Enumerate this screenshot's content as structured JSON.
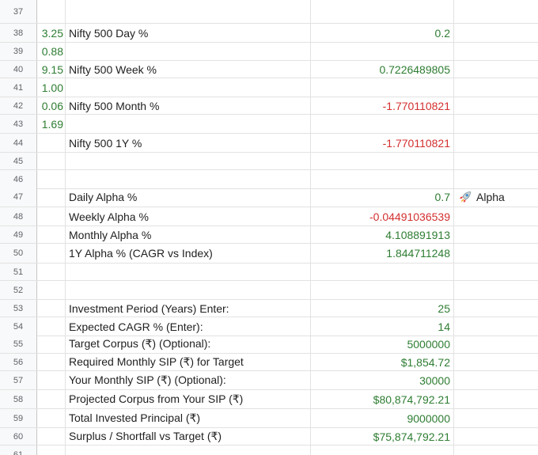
{
  "rows": [
    {
      "num": "37",
      "a": "",
      "b": "",
      "c": "",
      "d": ""
    },
    {
      "num": "38",
      "a": "3.25",
      "b": "Nifty 500 Day %",
      "c": "0.2",
      "d": ""
    },
    {
      "num": "39",
      "a": "0.88",
      "b": "",
      "c": "",
      "d": ""
    },
    {
      "num": "40",
      "a": "9.15",
      "b": "Nifty 500 Week %",
      "c": "0.7226489805",
      "d": ""
    },
    {
      "num": "41",
      "a": "1.00",
      "b": "",
      "c": "",
      "d": ""
    },
    {
      "num": "42",
      "a": "0.06",
      "b": "Nifty 500 Month %",
      "c": "-1.770110821",
      "d": ""
    },
    {
      "num": "43",
      "a": "1.69",
      "b": "",
      "c": "",
      "d": ""
    },
    {
      "num": "44",
      "a": "",
      "b": "Nifty 500 1Y %",
      "c": "-1.770110821",
      "d": ""
    },
    {
      "num": "45",
      "a": "",
      "b": "",
      "c": "",
      "d": ""
    },
    {
      "num": "46",
      "a": "",
      "b": "",
      "c": "",
      "d": ""
    },
    {
      "num": "47",
      "a": "",
      "b": "Daily Alpha %",
      "c": "0.7",
      "d": "Alpha"
    },
    {
      "num": "48",
      "a": "",
      "b": "Weekly Alpha %",
      "c": "-0.04491036539",
      "d": ""
    },
    {
      "num": "49",
      "a": "",
      "b": "Monthly Alpha %",
      "c": "4.108891913",
      "d": ""
    },
    {
      "num": "50",
      "a": "",
      "b": "1Y Alpha % (CAGR vs Index)",
      "c": "1.844711248",
      "d": ""
    },
    {
      "num": "51",
      "a": "",
      "b": "",
      "c": "",
      "d": ""
    },
    {
      "num": "52",
      "a": "",
      "b": "",
      "c": "",
      "d": ""
    },
    {
      "num": "53",
      "a": "",
      "b": "Investment Period (Years) Enter:",
      "c": "25",
      "d": ""
    },
    {
      "num": "54",
      "a": "",
      "b": "Expected CAGR % (Enter):",
      "c": "14",
      "d": ""
    },
    {
      "num": "55",
      "a": "",
      "b": "Target Corpus (₹) (Optional):",
      "c": "5000000",
      "d": ""
    },
    {
      "num": "56",
      "a": "",
      "b": "Required Monthly SIP (₹) for Target",
      "c": "$1,854.72",
      "d": ""
    },
    {
      "num": "57",
      "a": "",
      "b": "Your Monthly SIP (₹) (Optional):",
      "c": "30000",
      "d": ""
    },
    {
      "num": "58",
      "a": "",
      "b": "Projected Corpus from Your SIP (₹)",
      "c": "$80,874,792.21",
      "d": ""
    },
    {
      "num": "59",
      "a": "",
      "b": "Total Invested Principal (₹)",
      "c": "9000000",
      "d": ""
    },
    {
      "num": "60",
      "a": "",
      "b": "Surplus / Shortfall vs Target (₹)",
      "c": "$75,874,792.21",
      "d": ""
    },
    {
      "num": "61",
      "a": "",
      "b": "",
      "c": "",
      "d": ""
    }
  ],
  "icons": {
    "alpha_badge": "rocket-icon"
  },
  "colors": {
    "positive": "#2e7d32",
    "negative": "#d32f2f",
    "header_bg": "#f8f9fa",
    "gridline": "#e2e2e2"
  }
}
